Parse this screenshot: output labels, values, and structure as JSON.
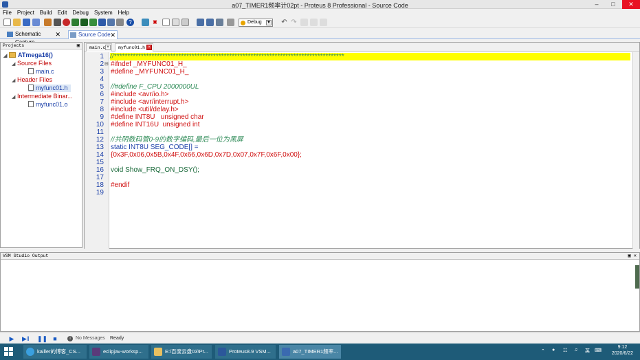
{
  "window": {
    "title": "a07_TIMER1频率计02pt - Proteus 8 Professional - Source Code"
  },
  "menu": [
    "File",
    "Project",
    "Build",
    "Edit",
    "Debug",
    "System",
    "Help"
  ],
  "toolbar": {
    "build_config": "Debug"
  },
  "tabs": [
    {
      "label": "Schematic Capture"
    },
    {
      "label": "Source Code"
    }
  ],
  "projects_panel": {
    "title": "Projects",
    "root": "ATmega16()",
    "groups": [
      {
        "label": "Source Files",
        "files": [
          "main.c"
        ]
      },
      {
        "label": "Header Files",
        "files": [
          "myfunc01.h"
        ]
      },
      {
        "label": "Intermediate Binar...",
        "files": [
          "myfunc01.o"
        ]
      }
    ]
  },
  "editor": {
    "tabs": [
      "main.c",
      "myfunc01.h"
    ],
    "line_numbers": [
      "1",
      "2",
      "3",
      "4",
      "5",
      "6",
      "7",
      "8",
      "9",
      "10",
      "11",
      "12",
      "13",
      "14",
      "15",
      "16",
      "17",
      "18",
      "19"
    ],
    "lines": [
      "//**************************************************************************************",
      "#ifndef _MYFUNC01_H_",
      "#define _MYFUNC01_H_",
      "",
      "//#define F_CPU 2000000UL",
      "#include <avr/io.h>",
      "#include <avr/interrupt.h>",
      "#include <util/delay.h>",
      "#define INT8U   unsigned char",
      "#define INT16U  unsigned int",
      "",
      "//共阴数码管0-9的数字编码,最后一位为黑屏",
      "static INT8U SEG_CODE[] =",
      "{0x3F,0x06,0x5B,0x4F,0x66,0x6D,0x7D,0x07,0x7F,0x6F,0x00};",
      "",
      "void Show_FRQ_ON_DSY();",
      "",
      "#endif",
      ""
    ]
  },
  "output_panel": {
    "title": "VSM Studio Output"
  },
  "statusbar": {
    "messages": "No Messages",
    "status": "Ready"
  },
  "taskbar": {
    "items": [
      "kailler的博客_CS...",
      "eclipjav-worksp...",
      "E:\\百度云盘03\\Pr...",
      "Proteus8.9 VSM...",
      "a07_TIMER1频率..."
    ],
    "tray_lang": "英",
    "clock_time": "9:12",
    "clock_date": "2020/6/22"
  }
}
